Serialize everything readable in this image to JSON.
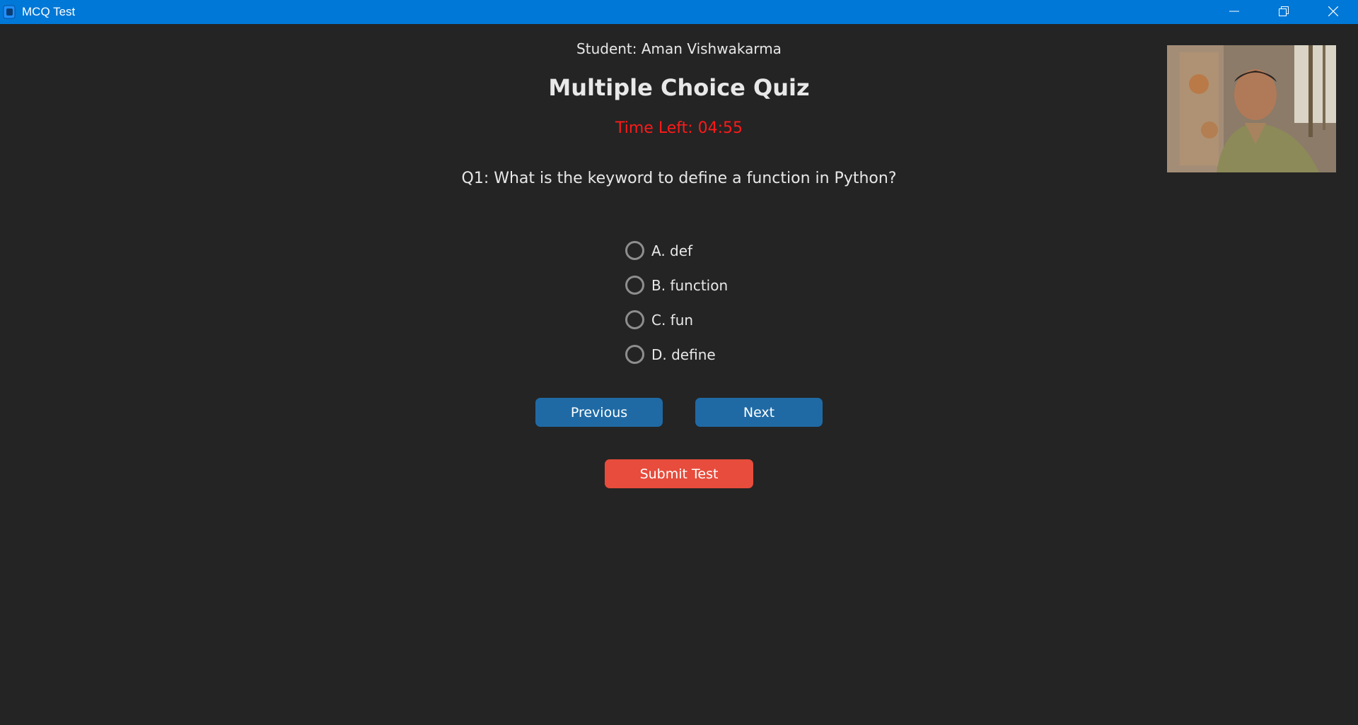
{
  "window": {
    "title": "MCQ Test",
    "icons": {
      "app": "app-icon",
      "minimize": "minimize-icon",
      "maximize": "restore-icon",
      "close": "close-icon"
    }
  },
  "header": {
    "student": "Student: Aman Vishwakarma",
    "title": "Multiple Choice Quiz",
    "timer": "Time Left: 04:55"
  },
  "question": {
    "text": "Q1: What is the keyword to define a function in Python?",
    "options": [
      {
        "label": "A. def",
        "selected": false
      },
      {
        "label": "B. function",
        "selected": false
      },
      {
        "label": "C. fun",
        "selected": false
      },
      {
        "label": "D. define",
        "selected": false
      }
    ]
  },
  "buttons": {
    "previous": "Previous",
    "next": "Next",
    "submit": "Submit Test"
  },
  "colors": {
    "titlebar": "#0078d7",
    "background": "#242424",
    "timer": "#ff1a1a",
    "nav_button": "#1f6aa5",
    "submit_button": "#e74c3c"
  }
}
